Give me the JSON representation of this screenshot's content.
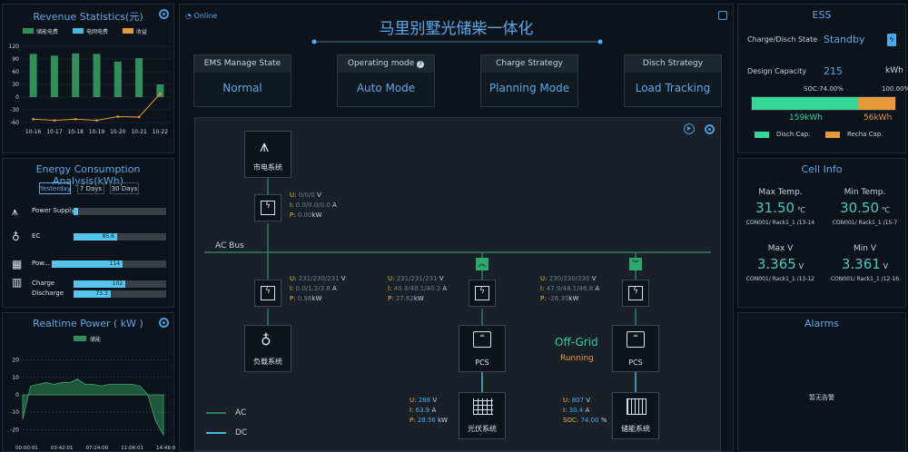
{
  "revenue": {
    "title": "Revenue Statistics(元)",
    "legend": [
      "储能电费",
      "电网电费",
      "收益"
    ],
    "chart_data": {
      "type": "bar",
      "categories": [
        "10-16",
        "10-17",
        "10-18",
        "10-19",
        "10-20",
        "10-21",
        "10-22"
      ],
      "series": [
        {
          "name": "储能电费",
          "values": [
            102,
            98,
            103,
            102,
            84,
            92,
            30
          ]
        },
        {
          "name": "电网电费",
          "values": [
            0,
            0,
            0,
            0,
            0,
            0,
            0
          ]
        },
        {
          "name": "收益",
          "values": [
            -52,
            -55,
            -52,
            -55,
            -46,
            -47,
            8
          ]
        }
      ],
      "yticks": [
        "120",
        "90",
        "60",
        "30",
        "0",
        "-30",
        "-60"
      ],
      "ylim": [
        -60,
        120
      ]
    }
  },
  "energy": {
    "title": "Energy Consumption Analysis(kWh)",
    "tabs": [
      "Yesterday",
      "7 Days",
      "30 Days"
    ],
    "rows": [
      {
        "label": "Power Supply",
        "value": "",
        "fraction": 0.05
      },
      {
        "label": "EC",
        "value": "85.6",
        "fraction": 0.47
      },
      {
        "label": "Pow...",
        "value": "114",
        "fraction": 0.62
      },
      {
        "label": "Charge",
        "value": "102",
        "fraction": 0.56
      },
      {
        "label": "Discharge",
        "value": "73.3",
        "fraction": 0.4
      }
    ]
  },
  "realtime": {
    "title": "Realtime Power ( kW )",
    "legend": "储能",
    "yticks": [
      "20",
      "10",
      "0",
      "-10",
      "-20"
    ],
    "xticks": [
      "00:00:01",
      "03:42:01",
      "07:24:00",
      "11:06:01",
      "14:48:01"
    ],
    "ylim": [
      -25,
      25
    ],
    "chart_data": {
      "type": "line",
      "x": [
        "00:00",
        "01:00",
        "02:00",
        "03:00",
        "04:00",
        "05:00",
        "06:00",
        "07:00",
        "08:00",
        "09:00",
        "10:00",
        "11:00",
        "12:00",
        "13:00",
        "14:00",
        "15:00",
        "16:00",
        "16:30",
        "17:00"
      ],
      "values": [
        -14,
        5,
        6,
        7,
        6,
        7,
        7,
        9,
        6,
        6,
        5,
        6,
        6,
        6,
        6,
        5,
        0,
        -15,
        -23
      ]
    }
  },
  "header": {
    "status": "Online",
    "title": "马里别墅光储柴一体化"
  },
  "states": [
    {
      "head": "EMS Manage State",
      "value": "Normal"
    },
    {
      "head": "Operating mode",
      "value": "Auto Mode"
    },
    {
      "head": "Charge Strategy",
      "value": "Planning Mode"
    },
    {
      "head": "Disch Strategy",
      "value": "Load Tracking"
    }
  ],
  "diagram": {
    "grid_label": "市电系统",
    "ac_bus": "AC Bus",
    "load_label": "负载系统",
    "pcs1_label": "PCS",
    "pcs2_label": "PCS",
    "pv_label": "光伏系统",
    "bat_label": "储能系统",
    "offgrid": "Off-Grid",
    "running": "Running",
    "legend_ac": "AC",
    "legend_dc": "DC",
    "grid_meter": {
      "u": "0/0/0",
      "i": "0.0/0.0/0.0",
      "p": "0.00"
    },
    "load_meter": {
      "u": "231/230/231",
      "i": "0.0/1.2/3.8",
      "p": "0.96"
    },
    "pcs1_meter": {
      "u": "231/231/231",
      "i": "40.3/40.1/40.2",
      "p": "27.62"
    },
    "pcs2_meter": {
      "u": "230/230/230",
      "i": "47.9/48.1/46.8",
      "p": "-26.30"
    },
    "pv_dc": {
      "u": "288",
      "i": "63.9",
      "p": "28.56"
    },
    "bat_dc": {
      "u": "807",
      "i": "30.4",
      "soc": "74.00"
    },
    "unit_v": "V",
    "unit_a": "A",
    "unit_kw": "kW",
    "unit_pct": "%"
  },
  "ess": {
    "title": "ESS",
    "state_label": "Charge/Disch State",
    "state_value": "Standby",
    "cap_label": "Design Capacity",
    "cap_value": "215",
    "cap_unit": "kWh",
    "soc_label": "SOC:74.00%",
    "full_label": "100.00%",
    "soc_fraction": 0.74,
    "disch_val": "159kWh",
    "recha_val": "56kWh",
    "legend_disch": "Disch Cap.",
    "legend_recha": "Recha Cap."
  },
  "cell": {
    "title": "Cell Info",
    "items": [
      {
        "label": "Max Temp.",
        "value": "31.50",
        "unit": "℃",
        "src": "CON001/ Rack1_1 /13-14"
      },
      {
        "label": "Min Temp.",
        "value": "30.50",
        "unit": "℃",
        "src": "CON001/ Rack1_1 /15-7"
      },
      {
        "label": "Max V",
        "value": "3.365",
        "unit": "V",
        "src": "CON001/ Rack1_1 /13-12"
      },
      {
        "label": "Min V",
        "value": "3.361",
        "unit": "V",
        "src": "CON001/ Rack1_1 /12-16"
      }
    ]
  },
  "alarms": {
    "title": "Alarms",
    "empty": "暂无告警"
  }
}
